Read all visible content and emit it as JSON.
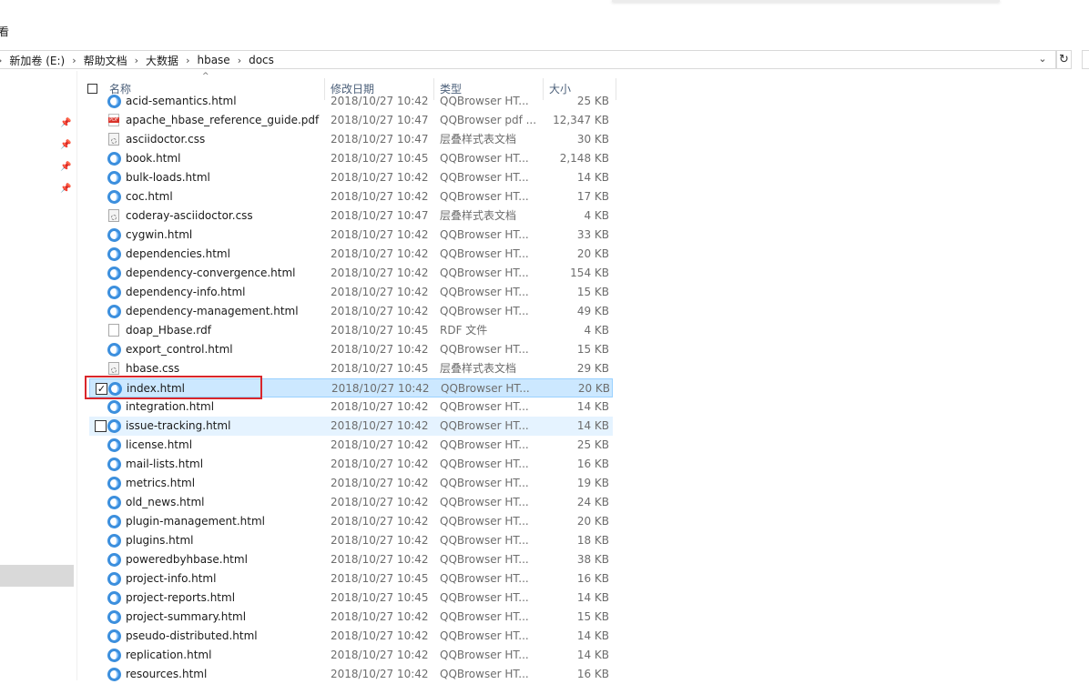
{
  "ribbon_fragment": "看",
  "address": {
    "crumbs": [
      "新加卷 (E:)",
      "帮助文档",
      "大数据",
      "hbase",
      "docs"
    ]
  },
  "columns": {
    "name": "名称",
    "date": "修改日期",
    "type": "类型",
    "size": "大小"
  },
  "files": [
    {
      "name": "acid-semantics.html",
      "date": "2018/10/27 10:42",
      "type": "QQBrowser HT...",
      "size": "25 KB",
      "icon": "html"
    },
    {
      "name": "apache_hbase_reference_guide.pdf",
      "date": "2018/10/27 10:47",
      "type": "QQBrowser pdf ...",
      "size": "12,347 KB",
      "icon": "pdf"
    },
    {
      "name": "asciidoctor.css",
      "date": "2018/10/27 10:47",
      "type": "层叠样式表文档",
      "size": "30 KB",
      "icon": "css"
    },
    {
      "name": "book.html",
      "date": "2018/10/27 10:45",
      "type": "QQBrowser HT...",
      "size": "2,148 KB",
      "icon": "html"
    },
    {
      "name": "bulk-loads.html",
      "date": "2018/10/27 10:42",
      "type": "QQBrowser HT...",
      "size": "14 KB",
      "icon": "html"
    },
    {
      "name": "coc.html",
      "date": "2018/10/27 10:42",
      "type": "QQBrowser HT...",
      "size": "17 KB",
      "icon": "html"
    },
    {
      "name": "coderay-asciidoctor.css",
      "date": "2018/10/27 10:47",
      "type": "层叠样式表文档",
      "size": "4 KB",
      "icon": "css"
    },
    {
      "name": "cygwin.html",
      "date": "2018/10/27 10:42",
      "type": "QQBrowser HT...",
      "size": "33 KB",
      "icon": "html"
    },
    {
      "name": "dependencies.html",
      "date": "2018/10/27 10:42",
      "type": "QQBrowser HT...",
      "size": "20 KB",
      "icon": "html"
    },
    {
      "name": "dependency-convergence.html",
      "date": "2018/10/27 10:42",
      "type": "QQBrowser HT...",
      "size": "154 KB",
      "icon": "html"
    },
    {
      "name": "dependency-info.html",
      "date": "2018/10/27 10:42",
      "type": "QQBrowser HT...",
      "size": "15 KB",
      "icon": "html"
    },
    {
      "name": "dependency-management.html",
      "date": "2018/10/27 10:42",
      "type": "QQBrowser HT...",
      "size": "49 KB",
      "icon": "html"
    },
    {
      "name": "doap_Hbase.rdf",
      "date": "2018/10/27 10:45",
      "type": "RDF 文件",
      "size": "4 KB",
      "icon": "file"
    },
    {
      "name": "export_control.html",
      "date": "2018/10/27 10:42",
      "type": "QQBrowser HT...",
      "size": "15 KB",
      "icon": "html"
    },
    {
      "name": "hbase.css",
      "date": "2018/10/27 10:45",
      "type": "层叠样式表文档",
      "size": "29 KB",
      "icon": "css"
    },
    {
      "name": "index.html",
      "date": "2018/10/27 10:42",
      "type": "QQBrowser HT...",
      "size": "20 KB",
      "icon": "html",
      "state": "selected",
      "checked": "☑"
    },
    {
      "name": "integration.html",
      "date": "2018/10/27 10:42",
      "type": "QQBrowser HT...",
      "size": "14 KB",
      "icon": "html"
    },
    {
      "name": "issue-tracking.html",
      "date": "2018/10/27 10:42",
      "type": "QQBrowser HT...",
      "size": "14 KB",
      "icon": "html",
      "state": "hover",
      "checked": ""
    },
    {
      "name": "license.html",
      "date": "2018/10/27 10:42",
      "type": "QQBrowser HT...",
      "size": "25 KB",
      "icon": "html"
    },
    {
      "name": "mail-lists.html",
      "date": "2018/10/27 10:42",
      "type": "QQBrowser HT...",
      "size": "16 KB",
      "icon": "html"
    },
    {
      "name": "metrics.html",
      "date": "2018/10/27 10:42",
      "type": "QQBrowser HT...",
      "size": "19 KB",
      "icon": "html"
    },
    {
      "name": "old_news.html",
      "date": "2018/10/27 10:42",
      "type": "QQBrowser HT...",
      "size": "24 KB",
      "icon": "html"
    },
    {
      "name": "plugin-management.html",
      "date": "2018/10/27 10:42",
      "type": "QQBrowser HT...",
      "size": "20 KB",
      "icon": "html"
    },
    {
      "name": "plugins.html",
      "date": "2018/10/27 10:42",
      "type": "QQBrowser HT...",
      "size": "18 KB",
      "icon": "html"
    },
    {
      "name": "poweredbyhbase.html",
      "date": "2018/10/27 10:42",
      "type": "QQBrowser HT...",
      "size": "38 KB",
      "icon": "html"
    },
    {
      "name": "project-info.html",
      "date": "2018/10/27 10:45",
      "type": "QQBrowser HT...",
      "size": "16 KB",
      "icon": "html"
    },
    {
      "name": "project-reports.html",
      "date": "2018/10/27 10:45",
      "type": "QQBrowser HT...",
      "size": "14 KB",
      "icon": "html"
    },
    {
      "name": "project-summary.html",
      "date": "2018/10/27 10:42",
      "type": "QQBrowser HT...",
      "size": "15 KB",
      "icon": "html"
    },
    {
      "name": "pseudo-distributed.html",
      "date": "2018/10/27 10:42",
      "type": "QQBrowser HT...",
      "size": "14 KB",
      "icon": "html"
    },
    {
      "name": "replication.html",
      "date": "2018/10/27 10:42",
      "type": "QQBrowser HT...",
      "size": "14 KB",
      "icon": "html"
    },
    {
      "name": "resources.html",
      "date": "2018/10/27 10:42",
      "type": "QQBrowser HT...",
      "size": "16 KB",
      "icon": "html"
    }
  ],
  "colors": {
    "selected_bg": "#cce8ff",
    "hover_bg": "#e5f3ff",
    "highlight_box": "#d9262b",
    "header_text": "#4c607a"
  }
}
